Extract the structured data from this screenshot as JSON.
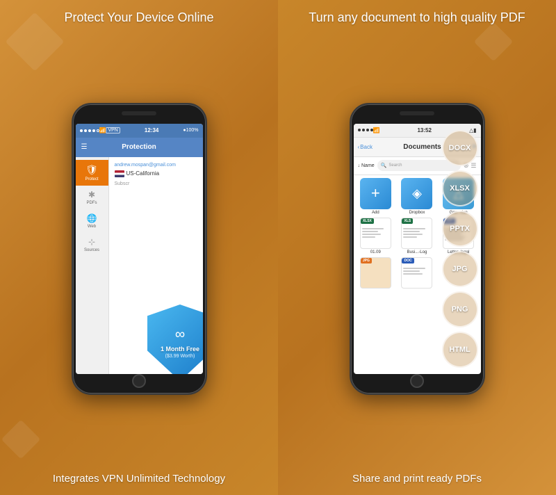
{
  "left": {
    "title": "Protect Your Device\nOnline",
    "footer": "Integrates VPN Unlimited\nTechnology",
    "phone": {
      "status_bar": {
        "dots": "●●●●●",
        "wifi": "WiFi",
        "carrier": "VPN",
        "time": "12:34",
        "battery_icon": "🔋",
        "battery": "100%"
      },
      "nav_title": "Protection",
      "email": "andrew.mospan@gmail.com",
      "location": "US-California",
      "subscription_label": "Subscr",
      "sidebar_items": [
        {
          "label": "Protect",
          "icon": "🛡",
          "active": true
        },
        {
          "label": "PDFs",
          "icon": "📄",
          "active": false
        },
        {
          "label": "Web",
          "icon": "🌐",
          "active": false
        },
        {
          "label": "Sources",
          "icon": "⚙",
          "active": false
        }
      ]
    },
    "shield": {
      "logo": "∞",
      "text": "1 Month Free",
      "subtext": "($3.99 Worth)"
    }
  },
  "right": {
    "title": "Turn any document to\nhigh quality PDF",
    "footer": "Share and print ready PDFs",
    "phone": {
      "status_bar": {
        "dots": "●●●●",
        "wifi": "WiFi",
        "time": "13:52",
        "bluetooth": "BT",
        "battery": "🔋"
      },
      "back_label": "Back",
      "nav_title": "Documents",
      "toolbar": {
        "sort_label": "↓ Name",
        "search_placeholder": "Search",
        "grid_icon": "⊞",
        "menu_icon": "≡"
      },
      "items": [
        {
          "type": "folder-add",
          "label": "Add",
          "icon": "+"
        },
        {
          "type": "folder-dropbox",
          "label": "Dropbox",
          "icon": "◈"
        },
        {
          "type": "folder-drive",
          "label": "Goo...rive",
          "icon": "△"
        },
        {
          "type": "file",
          "badge": "XLSX",
          "badge_class": "badge-xlsx",
          "label": "01.09"
        },
        {
          "type": "file",
          "badge": "XLS",
          "badge_class": "badge-xls",
          "label": "Busi...-Log"
        },
        {
          "type": "file",
          "badge": "DOC",
          "badge_class": "badge-doc",
          "label": "Letter_legal"
        },
        {
          "type": "file",
          "badge": "JPG",
          "badge_class": "badge-jpg",
          "label": ""
        },
        {
          "type": "file",
          "badge": "DOC",
          "badge_class": "badge-doc",
          "label": ""
        }
      ]
    },
    "format_pills": [
      "DOCX",
      "XLSX",
      "PPTX",
      "JPG",
      "PNG",
      "HTML"
    ]
  }
}
